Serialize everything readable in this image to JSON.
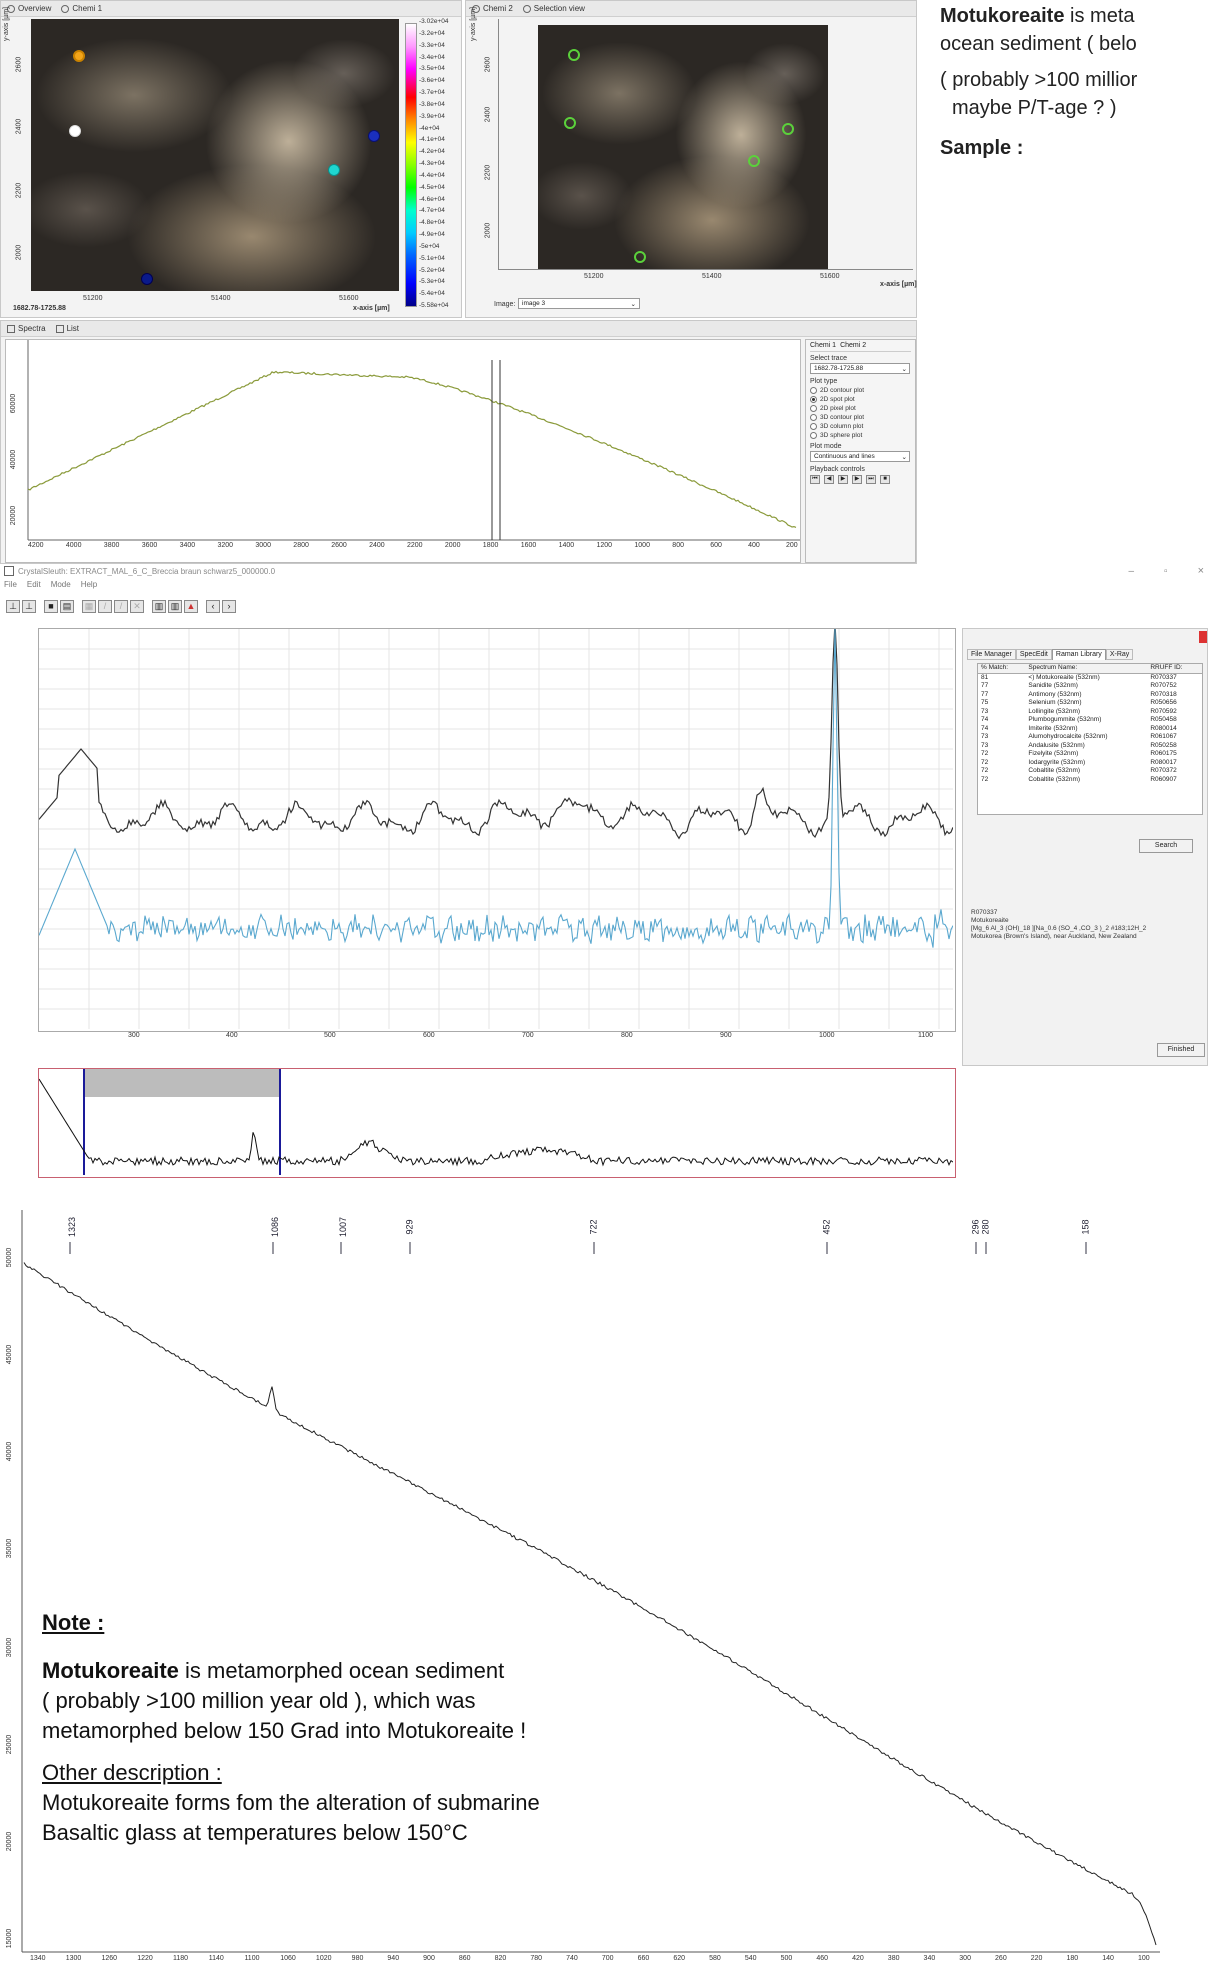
{
  "description_text": {
    "line1_bold": "Motukoreaite",
    "line1_rest": "is meta",
    "line2": "ocean sediment  ( belo",
    "line3": "( probably >100 millior",
    "line4": "maybe P/T-age ? )",
    "sample_label": "Sample :"
  },
  "top_left_window": {
    "tabs": [
      "Overview",
      "Chemi 1"
    ],
    "y_axis_label": "y-axis [µm]",
    "x_axis_label": "x-axis [µm]",
    "x_ticks": [
      "51200",
      "51400",
      "51600"
    ],
    "y_ticks": [
      "2600",
      "2400",
      "2200",
      "2000"
    ],
    "coord_label": "1682.78-1725.88",
    "colorbar_labels": [
      "-3.02e+04",
      "-3.2e+04",
      "-3.3e+04",
      "-3.4e+04",
      "-3.5e+04",
      "-3.6e+04",
      "-3.7e+04",
      "-3.8e+04",
      "-3.9e+04",
      "-4e+04",
      "-4.1e+04",
      "-4.2e+04",
      "-4.3e+04",
      "-4.4e+04",
      "-4.5e+04",
      "-4.6e+04",
      "-4.7e+04",
      "-4.8e+04",
      "-4.9e+04",
      "-5e+04",
      "-5.1e+04",
      "-5.2e+04",
      "-5.3e+04",
      "-5.4e+04",
      "-5.58e+04"
    ]
  },
  "top_right_window": {
    "tabs": [
      "Chemi 2",
      "Selection view"
    ],
    "y_axis_label": "y-axis [µm]",
    "x_axis_label": "x-axis [µm]",
    "x_ticks": [
      "51200",
      "51400",
      "51600"
    ],
    "y_ticks": [
      "2600",
      "2400",
      "2200",
      "2000"
    ],
    "image_label": "Image:",
    "image_select": "image 3"
  },
  "spectra_window": {
    "tabs": [
      "Spectra",
      "List"
    ],
    "y_ticks": [
      "60000",
      "40000",
      "20000"
    ],
    "x_ticks": [
      "4200",
      "4000",
      "3800",
      "3600",
      "3400",
      "3200",
      "3000",
      "2800",
      "2600",
      "2400",
      "2200",
      "2000",
      "1800",
      "1600",
      "1400",
      "1200",
      "1000",
      "800",
      "600",
      "400",
      "200"
    ],
    "right_tabs": [
      "Chemi 1",
      "Chemi 2"
    ],
    "select_trace_label": "Select trace",
    "select_trace_value": "1682.78-1725.88",
    "plot_type_label": "Plot type",
    "plot_types": [
      "2D contour plot",
      "2D spot plot",
      "2D pixel plot",
      "3D contour plot",
      "3D column plot",
      "3D sphere plot"
    ],
    "plot_type_selected": 1,
    "plot_mode_label": "Plot mode",
    "plot_mode_value": "Continuous and lines",
    "playback_label": "Playback controls"
  },
  "crystalsleuth": {
    "title": "CrystalSleuth: EXTRACT_MAL_6_C_Breccia braun schwarz5_000000.0",
    "menu": [
      "File",
      "Edit",
      "Mode",
      "Help"
    ],
    "window_controls": [
      "–",
      "▫",
      "×"
    ],
    "x_ticks": [
      "300",
      "400",
      "500",
      "600",
      "700",
      "800",
      "900",
      "1000",
      "1100"
    ],
    "library_tabs": [
      "File Manager",
      "SpecEdit",
      "Raman Library",
      "X-Ray"
    ],
    "library_headers": [
      "% Match:",
      "Spectrum Name:",
      "RRUFF ID:"
    ],
    "library_rows": [
      [
        "81",
        "<) Motukoreaite (532nm)",
        "R070337"
      ],
      [
        "77",
        "Sanidite (532nm)",
        "R070752"
      ],
      [
        "77",
        "Antimony (532nm)",
        "R070318"
      ],
      [
        "75",
        "Selenium (532nm)",
        "R050656"
      ],
      [
        "73",
        "Lollingite (532nm)",
        "R070592"
      ],
      [
        "74",
        "Plumbogummite (532nm)",
        "R050458"
      ],
      [
        "74",
        "Imiterite (532nm)",
        "R080014"
      ],
      [
        "73",
        "Alumohydrocalcite (532nm)",
        "R061067"
      ],
      [
        "73",
        "Andalusite (532nm)",
        "R050258"
      ],
      [
        "72",
        "Fizelyite (532nm)",
        "R060175"
      ],
      [
        "72",
        "Iodargyrite (532nm)",
        "R080017"
      ],
      [
        "72",
        "Cobaltite (532nm)",
        "R070372"
      ],
      [
        "72",
        "Cobaltite (532nm)",
        "R060907"
      ]
    ],
    "search_button": "Search",
    "info_id": "R070337",
    "info_name": "Motukoreaite",
    "info_formula": "[Mg_6 Al_3 (OH)_18 ][Na_0.6 (SO_4 ,CO_3 )_2 #183;12H_2",
    "info_locality": "Motukorea (Brown's Island), near Auckland, New Zealand",
    "finished_button": "Finished"
  },
  "bottom_chart": {
    "peak_labels": [
      "1323",
      "1086",
      "1007",
      "929",
      "722",
      "452",
      "296",
      "280",
      "158"
    ],
    "y_ticks": [
      "50000",
      "45000",
      "40000",
      "35000",
      "30000",
      "25000",
      "20000",
      "15000"
    ],
    "x_ticks": [
      "1340",
      "1300",
      "1260",
      "1220",
      "1180",
      "1140",
      "1100",
      "1060",
      "1020",
      "980",
      "940",
      "900",
      "860",
      "820",
      "780",
      "740",
      "700",
      "660",
      "620",
      "580",
      "540",
      "500",
      "460",
      "420",
      "380",
      "340",
      "300",
      "260",
      "220",
      "180",
      "140",
      "100"
    ]
  },
  "note_box": {
    "heading": "Note :",
    "p1_bold": "Motukoreaite",
    "p1_rest": " is  metamorphed ocean sediment",
    "p2": "( probably >100 million year old ), which was",
    "p3": "metamorphed below 150 Grad into Motukoreaite !",
    "heading2": "Other description :",
    "p4": "Motukoreaite forms fom the alteration of submarine",
    "p5": "Basaltic glass at temperatures below 150°C"
  },
  "colors": {
    "spectrum_green": "#8a9a3a",
    "spectrum_black": "#333333",
    "spectrum_blue": "#5aa8cf",
    "nav_box_red": "#c86070",
    "nav_cursor_blue": "#1a1a99"
  }
}
